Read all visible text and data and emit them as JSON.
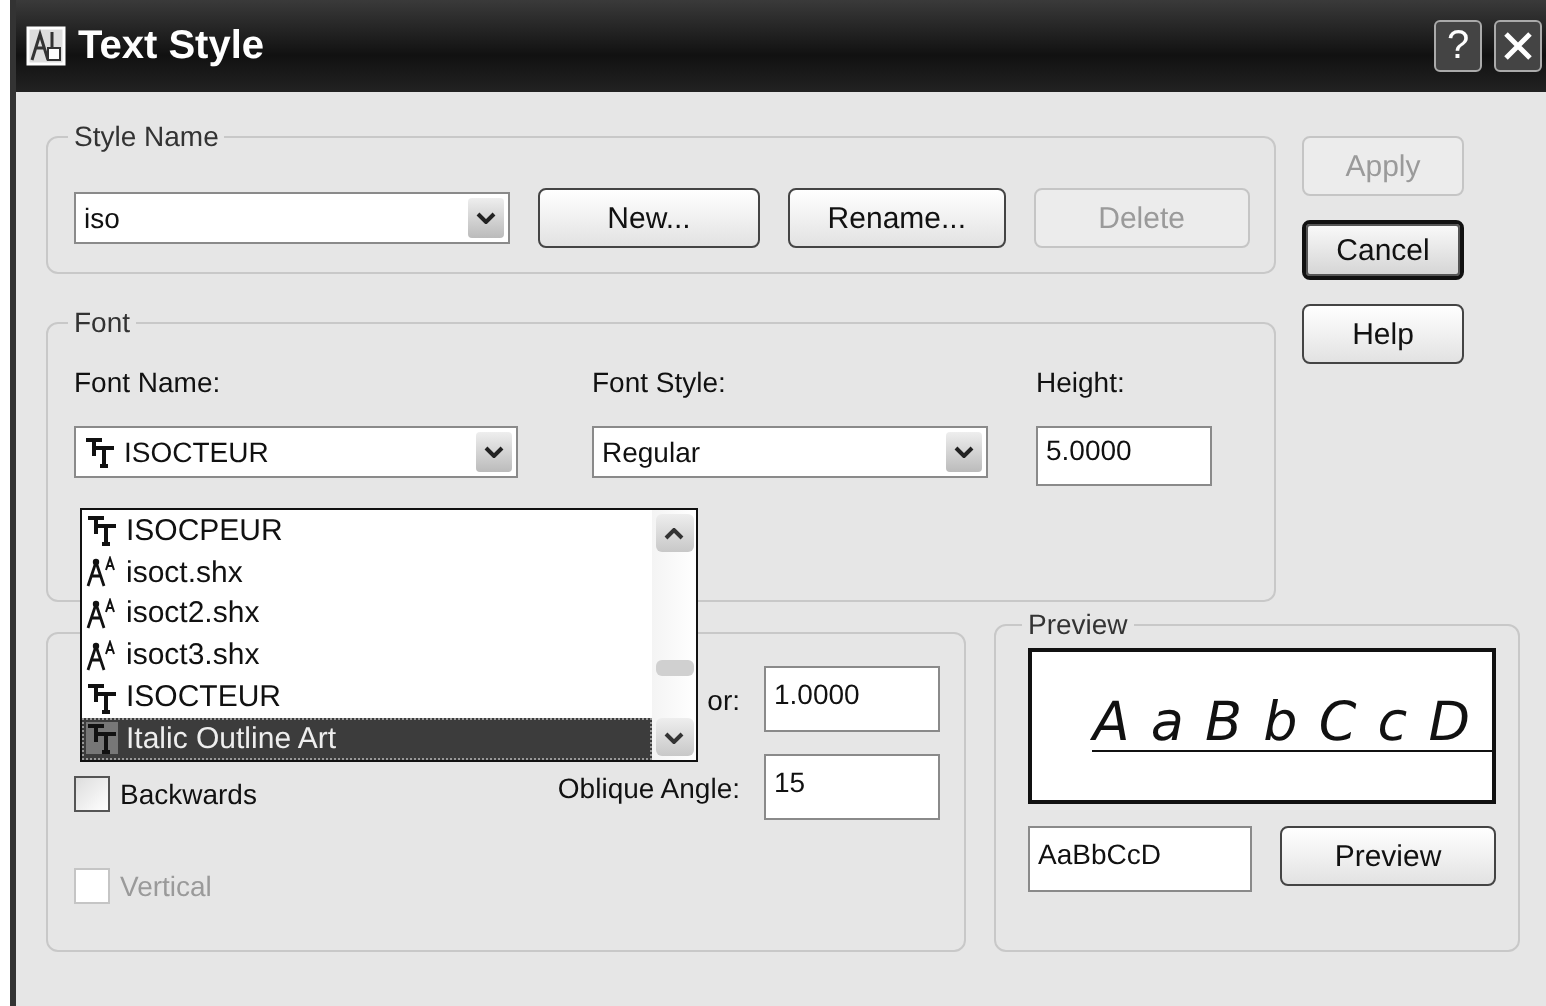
{
  "window": {
    "title": "Text Style",
    "help_glyph": "?"
  },
  "style_name": {
    "legend": "Style Name",
    "value": "iso",
    "buttons": [
      {
        "label": "New...",
        "disabled": false
      },
      {
        "label": "Rename...",
        "disabled": false
      },
      {
        "label": "Delete",
        "disabled": true
      }
    ]
  },
  "side_buttons": [
    {
      "label": "Apply",
      "disabled": true,
      "focused": false
    },
    {
      "label": "Cancel",
      "disabled": false,
      "focused": true
    },
    {
      "label": "Help",
      "disabled": false,
      "focused": false
    }
  ],
  "font": {
    "legend": "Font",
    "font_name_label": "Font Name:",
    "font_name_value": "ISOCTEUR",
    "font_style_label": "Font Style:",
    "font_style_value": "Regular",
    "height_label": "Height:",
    "height_value": "5.0000"
  },
  "font_list": [
    {
      "label": "ISOCPEUR",
      "kind": "truetype",
      "selected": false
    },
    {
      "label": "isoct.shx",
      "kind": "shx",
      "selected": false
    },
    {
      "label": "isoct2.shx",
      "kind": "shx",
      "selected": false
    },
    {
      "label": "isoct3.shx",
      "kind": "shx",
      "selected": false
    },
    {
      "label": "ISOCTEUR",
      "kind": "truetype",
      "selected": false
    },
    {
      "label": "Italic Outline Art",
      "kind": "truetype",
      "selected": true
    }
  ],
  "effects": {
    "width_factor_label": "or:",
    "width_factor_value": "1.0000",
    "oblique_label": "Oblique Angle:",
    "oblique_value": "15",
    "checkboxes": [
      {
        "label": "Backwards",
        "checked": false,
        "disabled": false
      },
      {
        "label": "Vertical",
        "checked": false,
        "disabled": true
      }
    ]
  },
  "preview": {
    "legend": "Preview",
    "sample": "A a B b C c D",
    "text": "AaBbCcD",
    "button": "Preview"
  }
}
